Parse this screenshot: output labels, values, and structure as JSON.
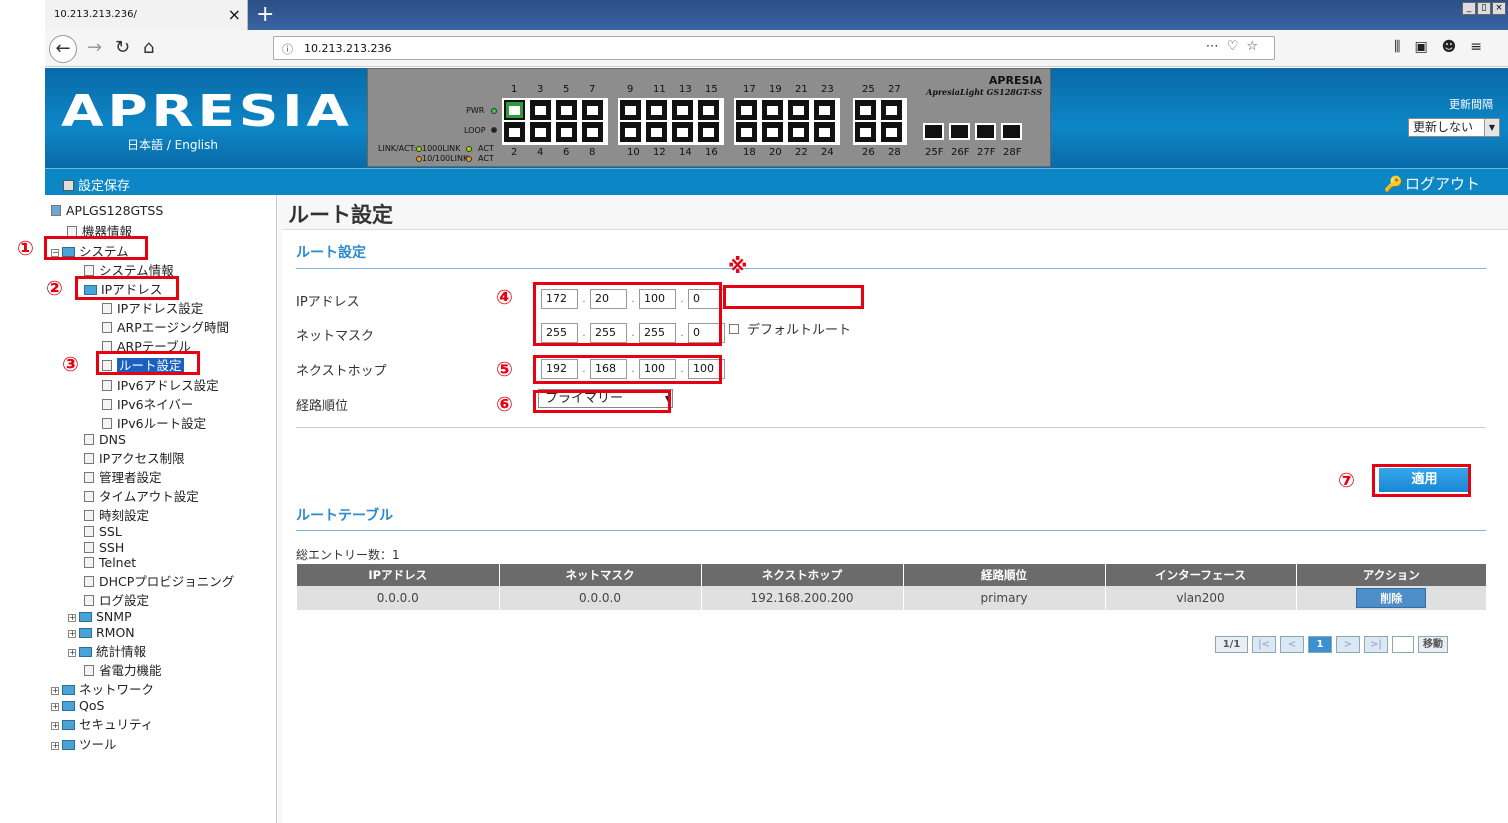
{
  "browser": {
    "tab_title": "10.213.213.236/",
    "tab_close": "×",
    "new_tab": "+",
    "url": "10.213.213.236",
    "window_controls": [
      "_",
      "▯",
      "×"
    ]
  },
  "header": {
    "logo": "APRESIA",
    "language": "日本語 / English",
    "refresh_label": "更新間隔",
    "refresh_value": "更新しない",
    "panel_brand": "APRESIA",
    "panel_model": "ApresiaLight GS128GT-SS",
    "panel_labels": {
      "pwr": "PWR",
      "loop": "LOOP",
      "link_act": "LINK/ACT:",
      "link1000": "1000LINK",
      "link100": "10/100LINK",
      "act": "ACT"
    },
    "top_ports": [
      "1",
      "3",
      "5",
      "7",
      "9",
      "11",
      "13",
      "15",
      "17",
      "19",
      "21",
      "23",
      "25",
      "27"
    ],
    "bottom_ports": [
      "2",
      "4",
      "6",
      "8",
      "10",
      "12",
      "14",
      "16",
      "18",
      "20",
      "22",
      "24",
      "26",
      "28"
    ],
    "sfp_ports": [
      "25F",
      "26F",
      "27F",
      "28F"
    ]
  },
  "toolbar": {
    "save": "設定保存",
    "logout": "ログアウト"
  },
  "tree": {
    "root": "APLGS128GTSS",
    "items": {
      "device_info": "機器情報",
      "system": "システム",
      "system_info": "システム情報",
      "ip_address": "IPアドレス",
      "ip_settings": "IPアドレス設定",
      "arp_aging": "ARPエージング時間",
      "arp_table": "ARPテーブル",
      "route_settings": "ルート設定",
      "ipv6_settings": "IPv6アドレス設定",
      "ipv6_neighbor": "IPv6ネイバー",
      "ipv6_route": "IPv6ルート設定",
      "dns": "DNS",
      "ip_access": "IPアクセス制限",
      "admin": "管理者設定",
      "timeout": "タイムアウト設定",
      "time": "時刻設定",
      "ssl": "SSL",
      "ssh": "SSH",
      "telnet": "Telnet",
      "dhcp": "DHCPプロビジョニング",
      "log": "ログ設定",
      "snmp": "SNMP",
      "rmon": "RMON",
      "stats": "統計情報",
      "power": "省電力機能",
      "network": "ネットワーク",
      "qos": "QoS",
      "security": "セキュリティ",
      "tools": "ツール"
    }
  },
  "annotations": {
    "m1": "①",
    "m2": "②",
    "m3": "③",
    "m4": "④",
    "m5": "⑤",
    "m6": "⑥",
    "m7": "⑦",
    "note": "※"
  },
  "main": {
    "page_title": "ルート設定",
    "section_title": "ルート設定",
    "ip_label": "IPアドレス",
    "netmask_label": "ネットマスク",
    "nexthop_label": "ネクストホップ",
    "priority_label": "経路順位",
    "ip": [
      "172",
      "20",
      "100",
      "0"
    ],
    "netmask": [
      "255",
      "255",
      "255",
      "0"
    ],
    "nexthop": [
      "192",
      "168",
      "100",
      "100"
    ],
    "default_route": "デフォルトルート",
    "priority_value": "プライマリー",
    "apply": "適用",
    "table_title": "ルートテーブル",
    "total": "総エントリー数：1",
    "columns": [
      "IPアドレス",
      "ネットマスク",
      "ネクストホップ",
      "経路順位",
      "インターフェース",
      "アクション"
    ],
    "rows": [
      {
        "ip": "0.0.0.0",
        "mask": "0.0.0.0",
        "nexthop": "192.168.200.200",
        "priority": "primary",
        "iface": "vlan200",
        "action": "削除"
      }
    ],
    "pager": {
      "pages": "1/1",
      "first": "|<",
      "prev": "<",
      "current": "1",
      "next": ">",
      "last": ">|",
      "go": "移動"
    }
  },
  "colors": {
    "accent_red": "#e60012",
    "header_blue": "#0d86c6",
    "section_blue": "#2d8ad0"
  }
}
